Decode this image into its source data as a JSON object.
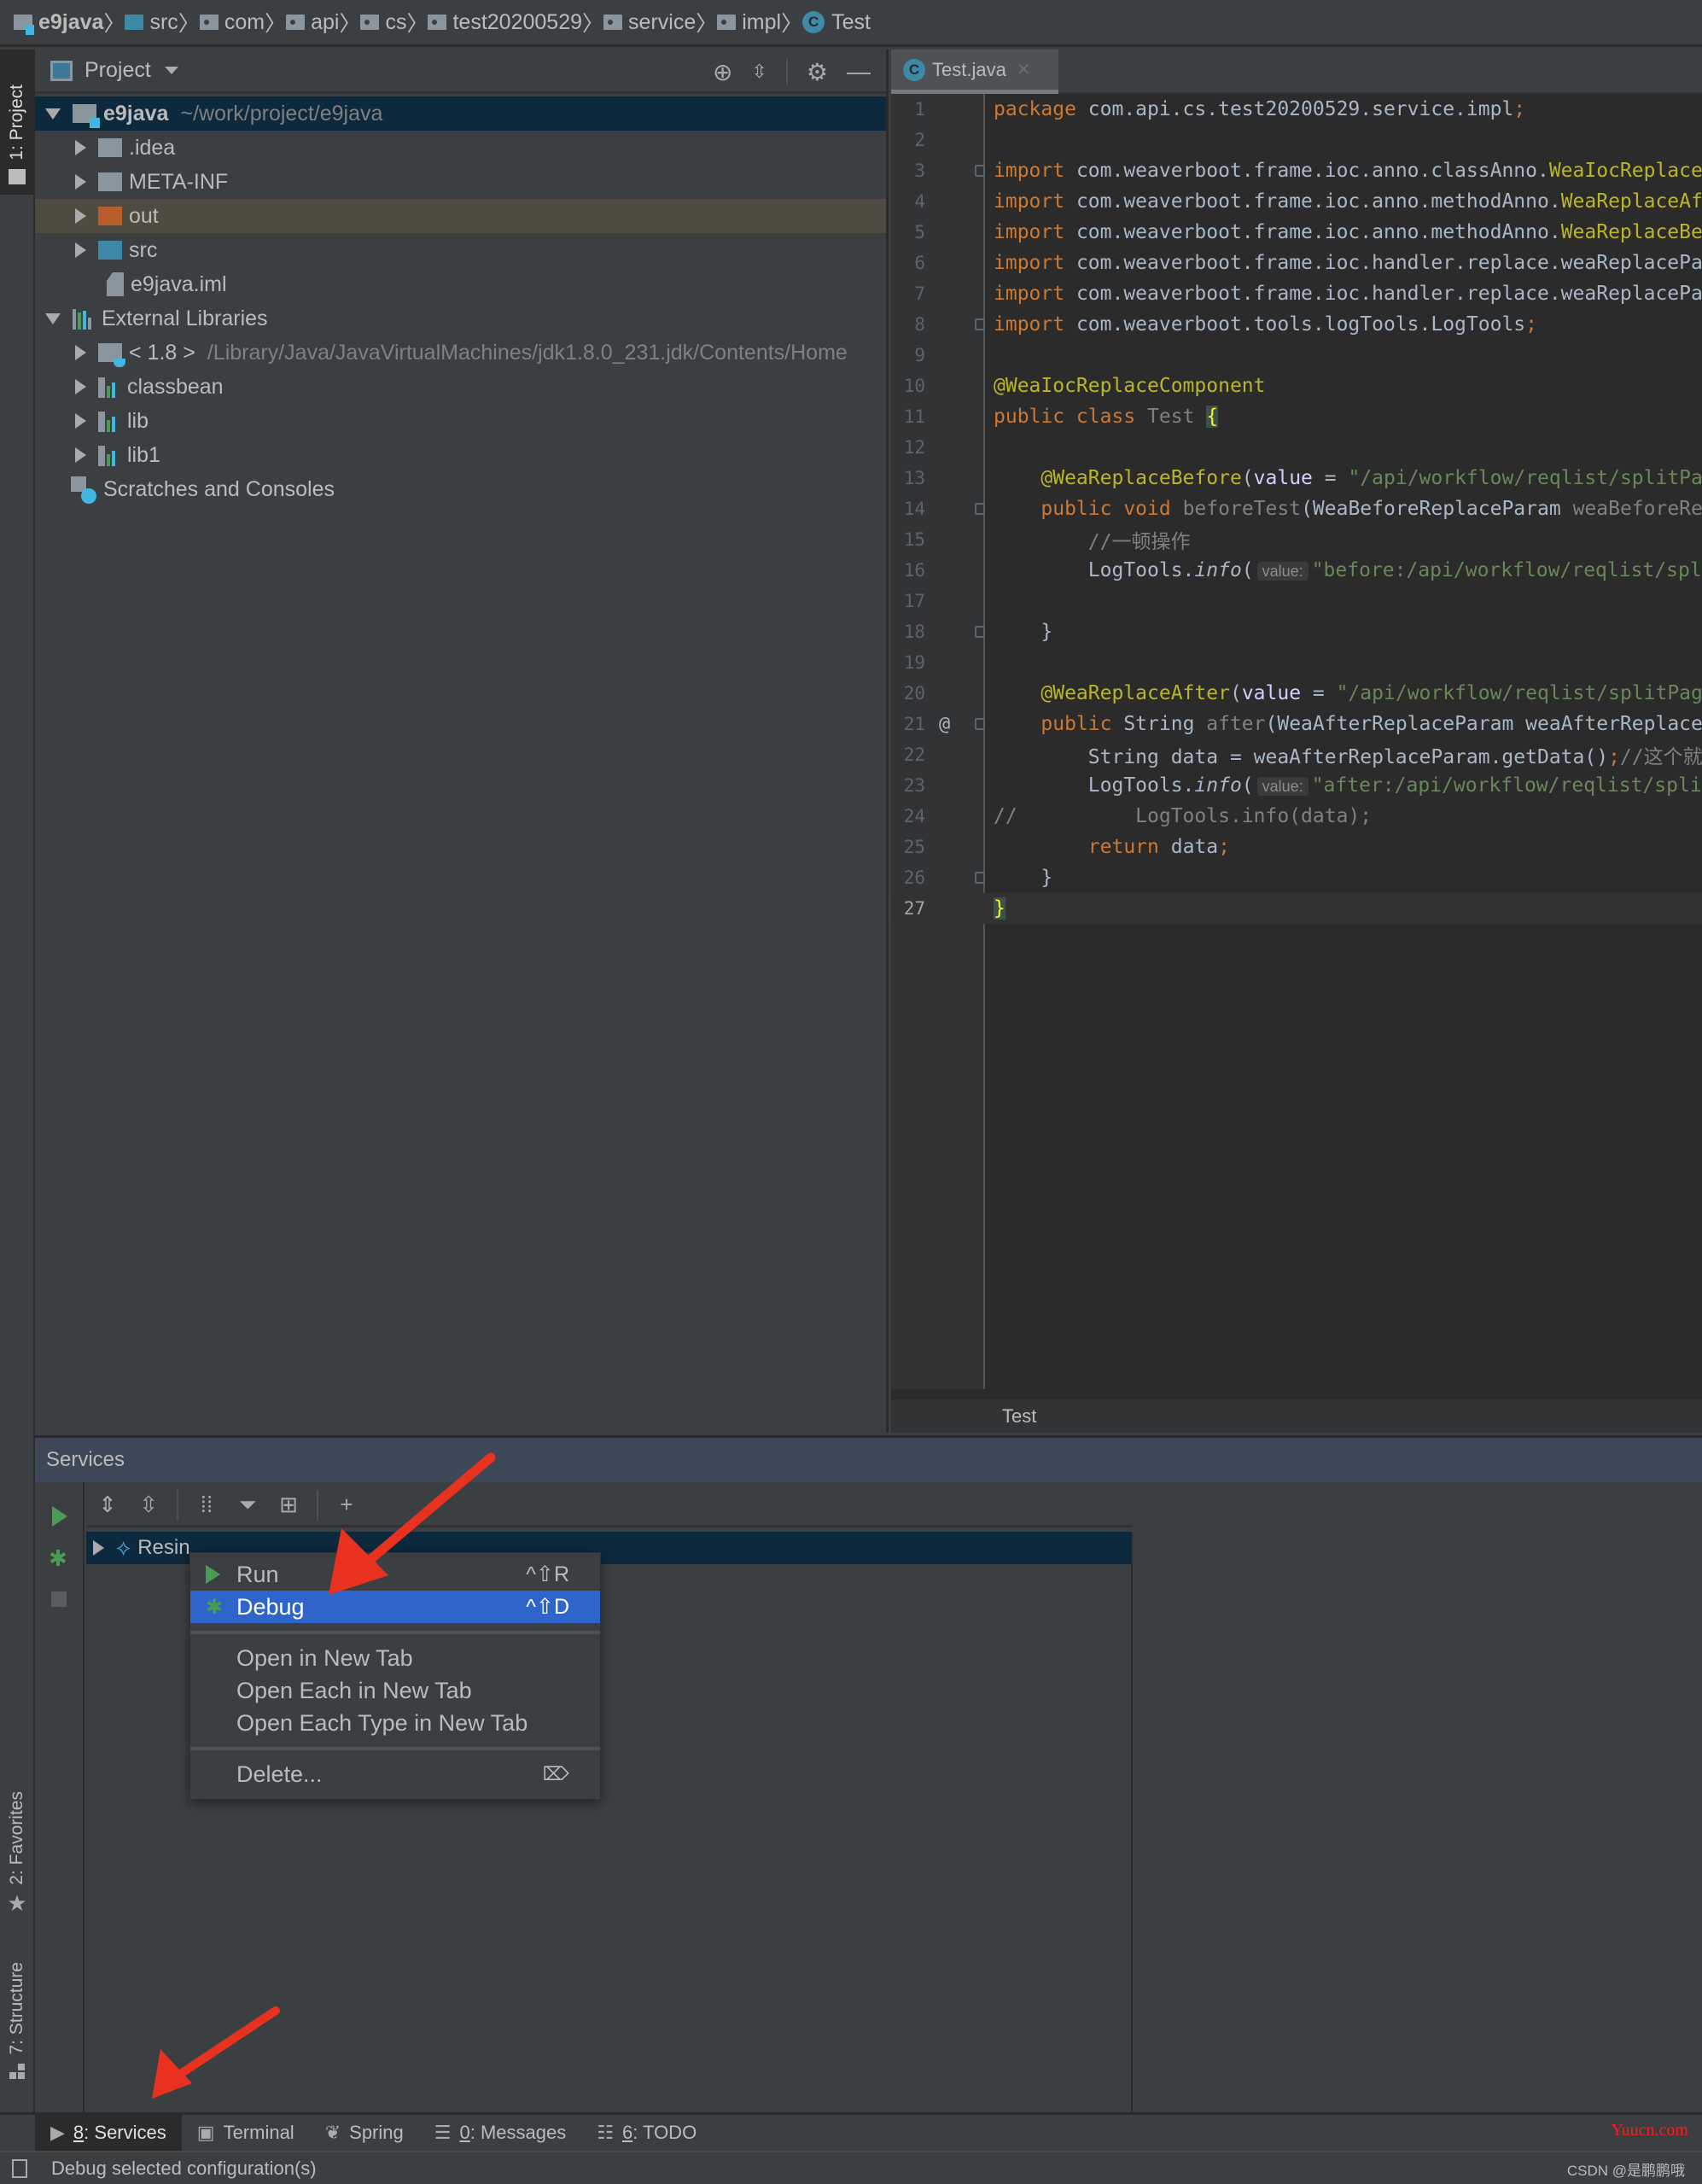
{
  "breadcrumb": [
    {
      "label": "e9java",
      "icon": "module-folder-icon",
      "bold": true
    },
    {
      "label": "src",
      "icon": "source-folder-icon"
    },
    {
      "label": "com",
      "icon": "package-icon"
    },
    {
      "label": "api",
      "icon": "package-icon"
    },
    {
      "label": "cs",
      "icon": "package-icon"
    },
    {
      "label": "test20200529",
      "icon": "package-icon"
    },
    {
      "label": "service",
      "icon": "package-icon"
    },
    {
      "label": "impl",
      "icon": "package-icon"
    },
    {
      "label": "Test",
      "icon": "class-icon"
    }
  ],
  "left_strip": {
    "project_tab": "1: Project",
    "favorites_tab": "2: Favorites",
    "structure_tab": "7: Structure"
  },
  "project_panel": {
    "title": "Project",
    "tree": [
      {
        "label": "e9java",
        "path": "~/work/project/e9java",
        "level": 0,
        "expanded": true,
        "icon": "module-folder-icon",
        "selected": true
      },
      {
        "label": ".idea",
        "level": 1,
        "expanded": false,
        "icon": "folder-icon"
      },
      {
        "label": "META-INF",
        "level": 1,
        "expanded": false,
        "icon": "folder-icon"
      },
      {
        "label": "out",
        "level": 1,
        "expanded": false,
        "icon": "excluded-folder-icon"
      },
      {
        "label": "src",
        "level": 1,
        "expanded": false,
        "icon": "source-folder-icon"
      },
      {
        "label": "e9java.iml",
        "level": 1,
        "icon": "iml-file-icon"
      },
      {
        "label": "External Libraries",
        "level": 0,
        "expanded": true,
        "icon": "libraries-icon"
      },
      {
        "label": "< 1.8 >",
        "path": "/Library/Java/JavaVirtualMachines/jdk1.8.0_231.jdk/Contents/Home",
        "level": 1,
        "expanded": false,
        "icon": "jdk-icon"
      },
      {
        "label": "classbean",
        "level": 1,
        "expanded": false,
        "icon": "library-icon"
      },
      {
        "label": "lib",
        "level": 1,
        "expanded": false,
        "icon": "library-icon"
      },
      {
        "label": "lib1",
        "level": 1,
        "expanded": false,
        "icon": "library-icon"
      },
      {
        "label": "Scratches and Consoles",
        "level": 0,
        "icon": "scratches-icon"
      }
    ]
  },
  "editor": {
    "tab_label": "Test.java",
    "breadcrumb": "Test",
    "current_line": 27
  },
  "services": {
    "title": "Services",
    "tree_item": "Resin"
  },
  "context_menu": {
    "items": [
      {
        "label": "Run",
        "shortcut": "^⇧R",
        "icon": "run-icon"
      },
      {
        "label": "Debug",
        "shortcut": "^⇧D",
        "icon": "debug-icon",
        "highlighted": true
      },
      {
        "label": "Open in New Tab"
      },
      {
        "label": "Open Each in New Tab"
      },
      {
        "label": "Open Each Type in New Tab"
      },
      {
        "label": "Delete...",
        "shortcut_icon": "delete-key-icon"
      }
    ]
  },
  "bottom_tabs": [
    {
      "label": "8: Services",
      "mnemonic": "8",
      "rest": ": Services",
      "active": true
    },
    {
      "label": "Terminal"
    },
    {
      "label": "Spring"
    },
    {
      "label": "0: Messages",
      "mnemonic": "0",
      "rest": ": Messages"
    },
    {
      "label": "6: TODO",
      "mnemonic": "6",
      "rest": ": TODO"
    }
  ],
  "status_bar": {
    "message": "Debug selected configuration(s)"
  },
  "watermarks": {
    "site": "Yuucn.com",
    "author": "CSDN @是鹏鹏哦"
  },
  "colors": {
    "menu_highlight": "#2f65ca",
    "selection": "#0d293e",
    "services_header": "#3d4757",
    "annotation_arrow": "#e8321f",
    "run_green": "#499c54"
  }
}
